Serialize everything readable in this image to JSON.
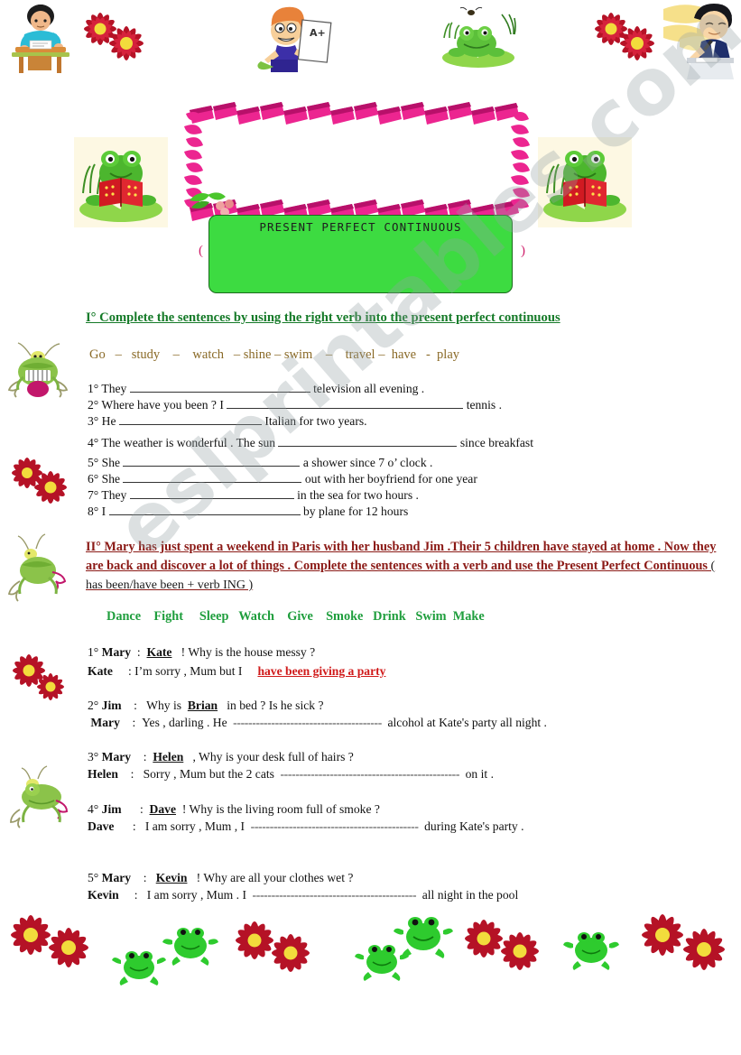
{
  "title_box": {
    "heading": "PRESENT   PERFECT   CONTINUOUS",
    "paren_left": "(",
    "paren_right": ")"
  },
  "watermark": {
    "text": "eslprintables.com"
  },
  "section1": {
    "heading": "I° Complete the sentences by using the right verb  into the  present perfect continuous",
    "verbs": [
      "Go",
      "study",
      "watch",
      "shine",
      "swim",
      "travel",
      "have",
      "play"
    ],
    "separators": [
      "–",
      "–",
      "–",
      "–",
      "–",
      "–",
      "-"
    ],
    "items": [
      {
        "num": "1°",
        "before": "They",
        "after": "television   all evening ."
      },
      {
        "num": "2°",
        "before": "Where have you been ? I",
        "after": "tennis ."
      },
      {
        "num": "3°",
        "before": "He",
        "after": "Italian  for two years."
      },
      {
        "num": "4°",
        "before": "The weather is wonderful  . The sun",
        "after": "since breakfast"
      },
      {
        "num": "5°",
        "before": "She",
        "after": "a  shower  since   7  o’ clock ."
      },
      {
        "num": "6°",
        "before": "She",
        "after": "out with her boyfriend for one year"
      },
      {
        "num": "7°",
        "before": "They",
        "after": "in the sea for  two hours ."
      },
      {
        "num": "8°",
        "before": "I",
        "after": "by  plane  for  12 hours"
      }
    ]
  },
  "section2": {
    "heading_bold": "II° Mary  has just spent a weekend in  Paris with her husband Jim   .Their  5 children have stayed at home  . Now they are back  and discover a lot of things  .   Complete the sentences with a verb and use   the Present Perfect Continuous",
    "heading_plain": " ( has been/have been + verb ING )",
    "verbs": [
      "Dance",
      "Fight",
      "Sleep",
      "Watch",
      "Give",
      "Smoke",
      "Drink",
      "Swim",
      "Make"
    ],
    "dialogues": [
      {
        "num": "1°",
        "q_speaker": "Mary",
        "q_colon": ":",
        "q_name": "Kate",
        "q_rest": "! Why is the house messy  ?",
        "a_speaker": "Kate",
        "a_colon": ":",
        "a_before": "I’m sorry  , Mum   but I",
        "a_answer": "have  been  giving  a  party",
        "a_after": ""
      },
      {
        "num": "2°",
        "q_speaker": "Jim",
        "q_colon": ":",
        "q_pre": "Why is",
        "q_name": "Brian",
        "q_rest": "in bed ?  Is he sick   ?",
        "a_speaker": "Mary",
        "a_colon": ":",
        "a_before": "Yes  , darling . He",
        "a_answer": "",
        "a_after": "alcohol   at  Kate's party   all night ."
      },
      {
        "num": "3°",
        "q_speaker": "Mary",
        "q_colon": ":",
        "q_name": "Helen",
        "q_rest": ", Why is   your desk    full of hairs ?",
        "a_speaker": "Helen",
        "a_colon": ":",
        "a_before": "Sorry , Mum but  the  2  cats",
        "a_answer": "",
        "a_after": "on it ."
      },
      {
        "num": "4°",
        "q_speaker": "Jim",
        "q_colon": ":",
        "q_name": "Dave",
        "q_rest": "! Why is   the living room  full of  smoke   ?",
        "a_speaker": "Dave",
        "a_colon": ":",
        "a_before": "I am sorry , Mum , I",
        "a_answer": "",
        "a_after": "during Kate's party ."
      },
      {
        "num": "5°",
        "q_speaker": "Mary",
        "q_colon": ":",
        "q_name": "Kevin",
        "q_rest": "! Why are all  your clothes wet  ?",
        "a_speaker": "Kevin",
        "a_colon": ":",
        "a_before": "I am sorry , Mum . I",
        "a_answer": "",
        "a_after": "all night  in the pool"
      }
    ]
  },
  "decorations": {
    "top": [
      "boy-at-desk-icon",
      "red-flowers-icon",
      "boy-with-paper-icon",
      "frog-on-lilypad-icon",
      "red-flowers-icon",
      "boy-writing-icon"
    ],
    "left_margin": [
      "grasshopper-icon",
      "red-flowers-icon",
      "grasshopper-icon",
      "red-flowers-icon",
      "frog-icon"
    ],
    "title_sides": [
      "reading-frog-icon",
      "reading-frog-icon"
    ],
    "bottom": [
      "red-flowers-icon",
      "frog-icon",
      "frog-icon",
      "red-flowers-icon",
      "frog-icon",
      "frog-icon",
      "red-flowers-icon",
      "frog-icon",
      "red-flowers-icon"
    ]
  },
  "colors": {
    "green_heading": "#157a28",
    "red_heading": "#8b1a16",
    "brown_verbs": "#8a6a27",
    "green_verbs": "#1f9e3d",
    "red_answer": "#d01a1a",
    "green_box": "#3ddb41",
    "ribbon_pink": "#e8238f"
  }
}
